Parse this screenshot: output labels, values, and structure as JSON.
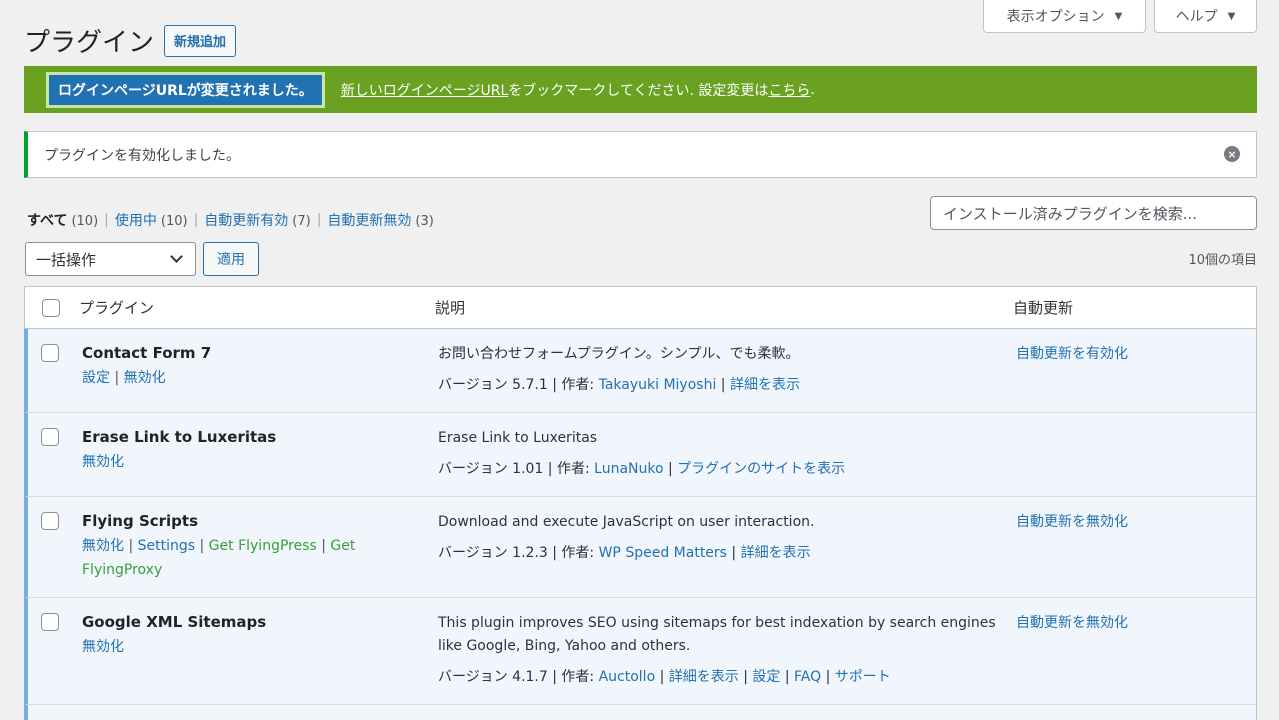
{
  "top_tabs": {
    "options": "表示オプション",
    "help": "ヘルプ"
  },
  "header": {
    "title": "プラグイン",
    "add_new": "新規追加"
  },
  "login_notice": {
    "badge": "ログインページURLが変更されました。",
    "link1": "新しいログインページURL",
    "text1": "をブックマークしてください. 設定変更は",
    "link2": "こちら",
    "text2": "."
  },
  "activated_notice": {
    "text": "プラグインを有効化しました。"
  },
  "filters": [
    {
      "label": "すべて",
      "count": "(10)"
    },
    {
      "label": "使用中",
      "count": "(10)"
    },
    {
      "label": "自動更新有効",
      "count": "(7)"
    },
    {
      "label": "自動更新無効",
      "count": "(3)"
    }
  ],
  "search": {
    "placeholder": "インストール済みプラグインを検索..."
  },
  "bulk": {
    "selected": "一括操作",
    "apply": "適用"
  },
  "items_count": "10個の項目",
  "table": {
    "columns": [
      "プラグイン",
      "説明",
      "自動更新"
    ],
    "rows": [
      {
        "name": "Contact Form 7",
        "actions": [
          "設定",
          "無効化"
        ],
        "description": "お問い合わせフォームプラグイン。シンプル、でも柔軟。",
        "version": "バージョン 5.7.1",
        "by": "作者:",
        "author": "Takayuki Miyoshi",
        "links": [
          "詳細を表示"
        ],
        "auto": "自動更新を有効化"
      },
      {
        "name": "Erase Link to Luxeritas",
        "actions": [
          "無効化"
        ],
        "description": "Erase Link to Luxeritas",
        "version": "バージョン 1.01",
        "by": "作者:",
        "author": "LunaNuko",
        "links": [
          "プラグインのサイトを表示"
        ],
        "auto": ""
      },
      {
        "name": "Flying Scripts",
        "actions": [
          "無効化",
          "Settings",
          "Get FlyingPress",
          "Get FlyingProxy"
        ],
        "description": "Download and execute JavaScript on user interaction.",
        "version": "バージョン 1.2.3",
        "by": "作者:",
        "author": "WP Speed Matters",
        "links": [
          "詳細を表示"
        ],
        "auto": "自動更新を無効化"
      },
      {
        "name": "Google XML Sitemaps",
        "actions": [
          "無効化"
        ],
        "description": "This plugin improves SEO using sitemaps for best indexation by search engines like Google, Bing, Yahoo and others.",
        "version": "バージョン 4.1.7",
        "by": "作者:",
        "author": "Auctollo",
        "links": [
          "詳細を表示",
          "設定",
          "FAQ",
          "サポート"
        ],
        "auto": "自動更新を無効化"
      }
    ]
  },
  "colors": {
    "accent": "#2271b1",
    "notice_green": "#6aa121",
    "success_border": "#00a32a",
    "active_row": "#f0f6fc",
    "active_border": "#72aee6"
  }
}
